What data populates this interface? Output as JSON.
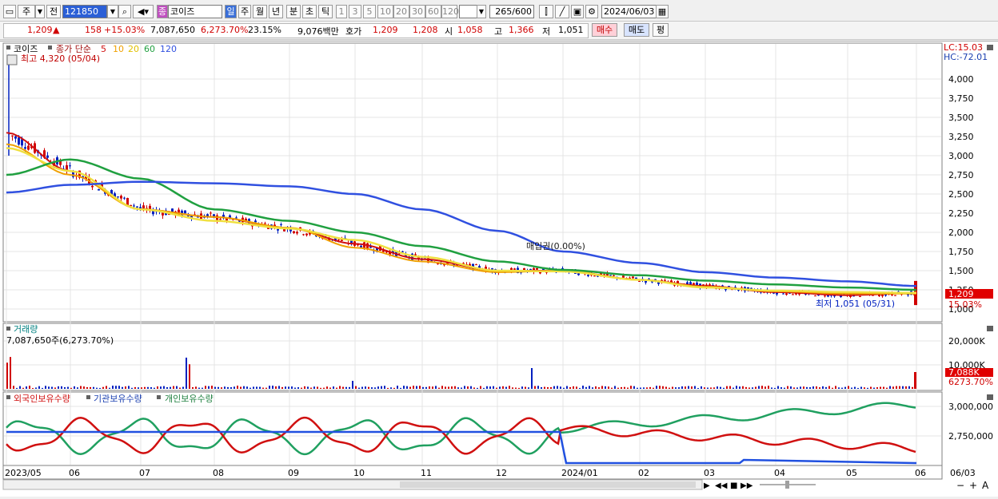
{
  "toolbar": {
    "period_main": "주",
    "prefix": "전",
    "code": "121850",
    "badge": "종",
    "name": "코이즈",
    "periods": [
      "일",
      "주",
      "월",
      "년",
      "분",
      "초",
      "틱"
    ],
    "intervals": [
      "1",
      "3",
      "5",
      "10",
      "20",
      "30",
      "60",
      "120"
    ],
    "count": "265",
    "count_max": "/600",
    "date": "2024/06/03"
  },
  "quote": {
    "price": "1,209",
    "arrow": "▲",
    "change": "158",
    "change_pct": "+15.03%",
    "volume": "7,087,650",
    "volume_pct": "6,273.70%",
    "turnover": "23.15%",
    "amount": "9,076백만",
    "bid_label": "호가",
    "bid1": "1,209",
    "bid2": "1,208",
    "open_label": "시",
    "open": "1,058",
    "high_label": "고",
    "high": "1,366",
    "low_label": "저",
    "low": "1,051",
    "buy": "매수",
    "sell": "매도",
    "flat": "평"
  },
  "price_panel": {
    "stock_label": "코이즈",
    "ma_title": "종가 단순",
    "ma_periods": [
      "5",
      "10",
      "20",
      "60",
      "120"
    ],
    "max_label": "최고 4,320 (05/04)",
    "min_label": "최저 1,051 (05/31)",
    "event_label": "매입권(0.00%)",
    "lc": "LC:15.03",
    "hc": "HC:-72.01",
    "y_ticks": [
      "4,000",
      "3,750",
      "3,500",
      "3,250",
      "3,000",
      "2,750",
      "2,500",
      "2,250",
      "2,000",
      "1,750",
      "1,500",
      "1,250",
      "1,000"
    ],
    "last_price": "1,209",
    "last_pct": "15.03%"
  },
  "volume_panel": {
    "title": "거래량",
    "value": "7,087,650주(6,273.70%)",
    "y_ticks": [
      "20,000K",
      "10,000K"
    ],
    "last_value": "7,088K",
    "last_pct": "6273.70%"
  },
  "holding_panel": {
    "series": [
      "외국인보유수량",
      "기관보유수량",
      "개인보유수량"
    ],
    "y_ticks": [
      "3,000,000",
      "2,750,000"
    ]
  },
  "x_axis": {
    "labels": [
      "2023/05",
      "06",
      "07",
      "08",
      "09",
      "10",
      "11",
      "12",
      "2024/01",
      "02",
      "03",
      "04",
      "05",
      "06"
    ],
    "right_label": "06/03"
  },
  "colors": {
    "ma5": "#d01010",
    "ma10": "#f0a000",
    "ma20": "#f0e040",
    "ma60": "#20a040",
    "ma120": "#3050e0",
    "up": "#d00000",
    "down": "#0020c0"
  },
  "chart_data": {
    "type": "line",
    "x": [
      "2023/05",
      "06",
      "07",
      "08",
      "09",
      "10",
      "11",
      "12",
      "2024/01",
      "02",
      "03",
      "04",
      "05",
      "06"
    ],
    "series": [
      {
        "name": "5",
        "values": [
          3300,
          2800,
          2300,
          2200,
          2050,
          1850,
          1650,
          1500,
          1500,
          1380,
          1300,
          1220,
          1180,
          1209
        ]
      },
      {
        "name": "10",
        "values": [
          3150,
          2750,
          2300,
          2200,
          2060,
          1800,
          1620,
          1480,
          1500,
          1380,
          1290,
          1230,
          1200,
          1200
        ]
      },
      {
        "name": "20",
        "values": [
          3100,
          2800,
          2300,
          2150,
          2050,
          1900,
          1680,
          1500,
          1490,
          1380,
          1280,
          1240,
          1220,
          1210
        ]
      },
      {
        "name": "60",
        "values": [
          2750,
          2950,
          2700,
          2300,
          2150,
          2000,
          1820,
          1620,
          1510,
          1440,
          1370,
          1320,
          1280,
          1250
        ]
      },
      {
        "name": "120",
        "values": [
          2520,
          2620,
          2660,
          2640,
          2600,
          2500,
          2300,
          2020,
          1750,
          1600,
          1480,
          1410,
          1360,
          1300
        ]
      }
    ],
    "ylim": [
      1000,
      4000
    ],
    "max": 4320,
    "min": 1051,
    "volume_ylim": [
      0,
      20000
    ]
  }
}
